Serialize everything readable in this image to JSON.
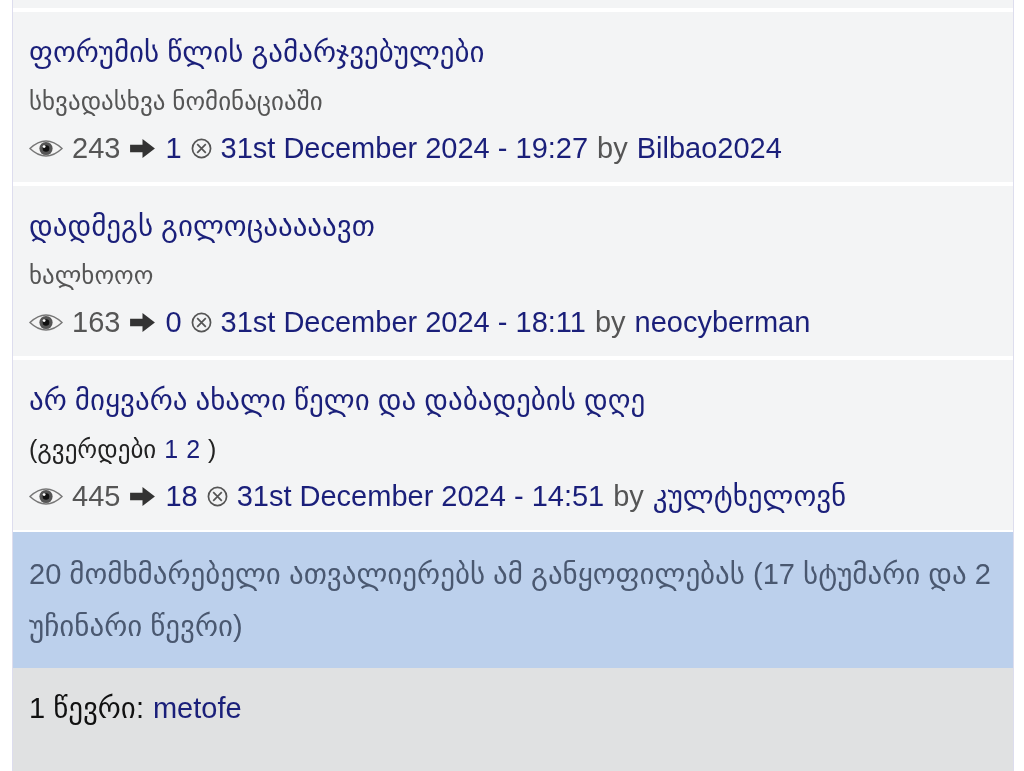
{
  "topics": [
    {
      "title": "ფორუმის წლის გამარჯვებულები",
      "subtitle": "სხვადასხვა ნომინაციაში",
      "views": "243",
      "replies": "1",
      "date": "31st December 2024 - 19:27",
      "by": "by",
      "author": "Bilbao2024"
    },
    {
      "title": "დადმეგს გილოცააააავთ",
      "subtitle": "ხალხოოო",
      "views": "163",
      "replies": "0",
      "date": "31st December 2024 - 18:11",
      "by": "by",
      "author": "neocyberman"
    },
    {
      "title": "არ მიყვარა ახალი წელი და დაბადების დღე",
      "pages": {
        "open": "(გვერდები",
        "links": [
          "1",
          "2"
        ],
        "close": ")"
      },
      "views": "445",
      "replies": "18",
      "date": "31st December 2024 - 14:51",
      "by": "by",
      "author": "კულტხელოვნ"
    }
  ],
  "viewers": "20 მომხმარებელი ათვალიერებს ამ განყოფილებას (17 სტუმარი და 2 უჩინარი წევრი)",
  "members": {
    "label": "1 წევრი:",
    "names": [
      "metofe"
    ]
  }
}
